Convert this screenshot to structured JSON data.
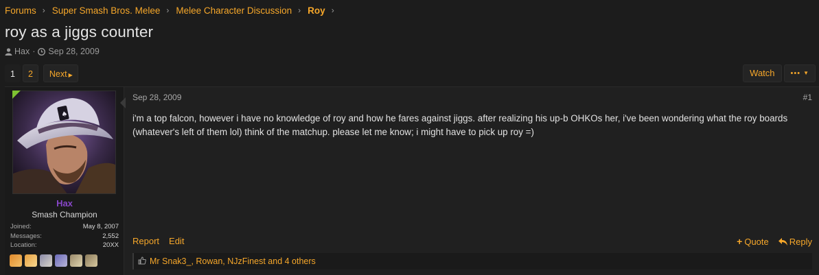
{
  "breadcrumb": [
    {
      "label": "Forums"
    },
    {
      "label": "Super Smash Bros. Melee"
    },
    {
      "label": "Melee Character Discussion"
    },
    {
      "label": "Roy"
    }
  ],
  "thread": {
    "title": "roy as a jiggs counter",
    "author": "Hax",
    "date": "Sep 28, 2009"
  },
  "pagination": {
    "pages": [
      "1",
      "2"
    ],
    "current": "1",
    "next_label": "Next"
  },
  "actions": {
    "watch_label": "Watch",
    "more_label": "•••"
  },
  "post": {
    "user": {
      "name": "Hax",
      "name_color": "#8847c9",
      "title": "Smash Champion",
      "stats": [
        {
          "label": "Joined:",
          "value": "May 8, 2007"
        },
        {
          "label": "Messages:",
          "value": "2,552"
        },
        {
          "label": "Location:",
          "value": "20XX"
        }
      ],
      "badges": [
        "fox-icon",
        "fox-icon",
        "falco-icon",
        "wolf-icon",
        "falco-icon",
        "falco-icon"
      ]
    },
    "date": "Sep 28, 2009",
    "number": "#1",
    "body": "i'm a top falcon, however i have no knowledge of roy and how he fares against jiggs. after realizing his up-b OHKOs her, i've been wondering what the roy boards (whatever's left of them lol) think of the matchup. please let me know; i might have to pick up roy =)",
    "footer": {
      "report_label": "Report",
      "edit_label": "Edit",
      "quote_label": "Quote",
      "reply_label": "Reply"
    },
    "reactions_text": "Mr Snak3_, Rowan, NJzFinest and 4 others"
  },
  "colors": {
    "accent": "#f6a72a",
    "background": "#1c1c1c",
    "online": "#7ec232"
  }
}
